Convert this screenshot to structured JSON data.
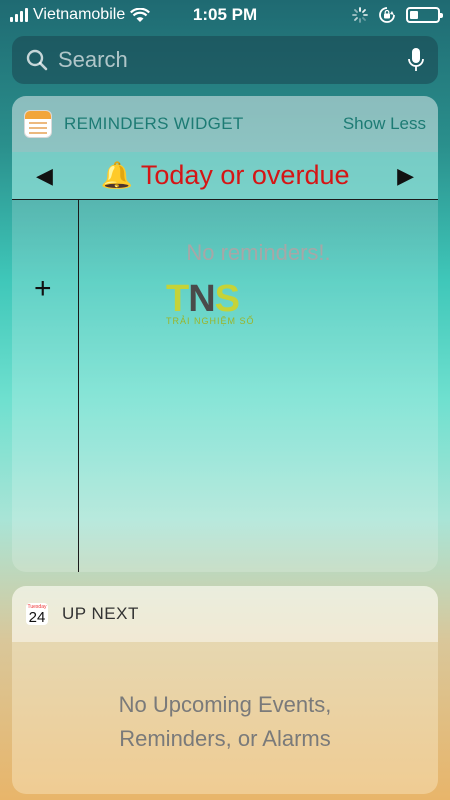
{
  "status_bar": {
    "carrier": "Vietnamobile",
    "time": "1:05 PM",
    "signal_bars": 4,
    "battery_level": 0.3
  },
  "search": {
    "placeholder": "Search",
    "value": ""
  },
  "reminders_widget": {
    "title": "REMINDERS WIDGET",
    "toggle_label": "Show Less",
    "filter_label": "Today or overdue",
    "prev_arrow": "◀",
    "next_arrow": "▶",
    "add_label": "+",
    "empty_message": "No reminders!."
  },
  "watermark": {
    "text_t": "T",
    "text_n": "N",
    "text_s": "S",
    "tagline": "TRẢI NGHIỆM SỐ"
  },
  "upnext_widget": {
    "calendar_day": "24",
    "calendar_weekday": "Tuesday",
    "title": "UP NEXT",
    "empty_line1": "No Upcoming Events,",
    "empty_line2": "Reminders, or Alarms"
  },
  "colors": {
    "accent": "#1d7b74",
    "filter_red": "#d51515"
  },
  "icons": [
    "signal-icon",
    "wifi-icon",
    "rotation-lock-icon",
    "loading-icon",
    "battery-icon",
    "search-icon",
    "microphone-icon",
    "reminders-app-icon",
    "bell-icon",
    "calendar-icon"
  ]
}
